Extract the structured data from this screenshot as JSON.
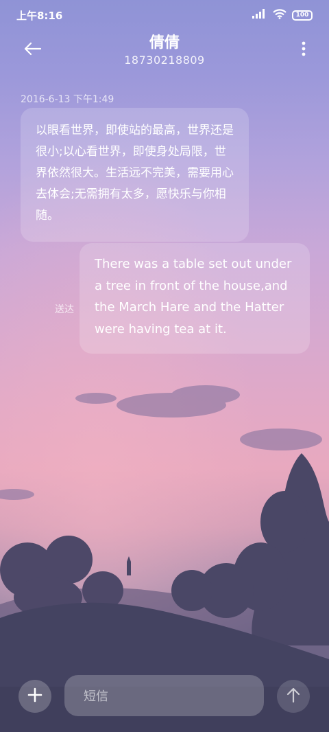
{
  "status_bar": {
    "time": "上午8:16",
    "battery": "100",
    "signal_icon": "signal-bars-icon",
    "wifi_icon": "wifi-icon"
  },
  "header": {
    "title": "倩倩",
    "subtitle": "18730218809",
    "back_icon": "back-arrow-icon",
    "more_icon": "more-vertical-icon"
  },
  "messages": {
    "timestamp": "2016-6-13 下午1:49",
    "incoming": {
      "text": "以眼看世界，即使站的最高，世界还是很小;以心看世界，即使身处局限，世界依然很大。生活远不完美，需要用心去体会;无需拥有太多，愿快乐与你相随。"
    },
    "outgoing": {
      "text": "There was a table set out under a tree in front of the house,and the March Hare and the Hatter were having tea at it.",
      "status": "送达"
    }
  },
  "input_bar": {
    "placeholder": "短信",
    "add_icon": "plus-icon",
    "send_icon": "send-arrow-icon"
  },
  "colors": {
    "sky_top": "#8f93d6",
    "sky_pink": "#e8a9bf",
    "tree_silhouette": "#4a4a63"
  }
}
